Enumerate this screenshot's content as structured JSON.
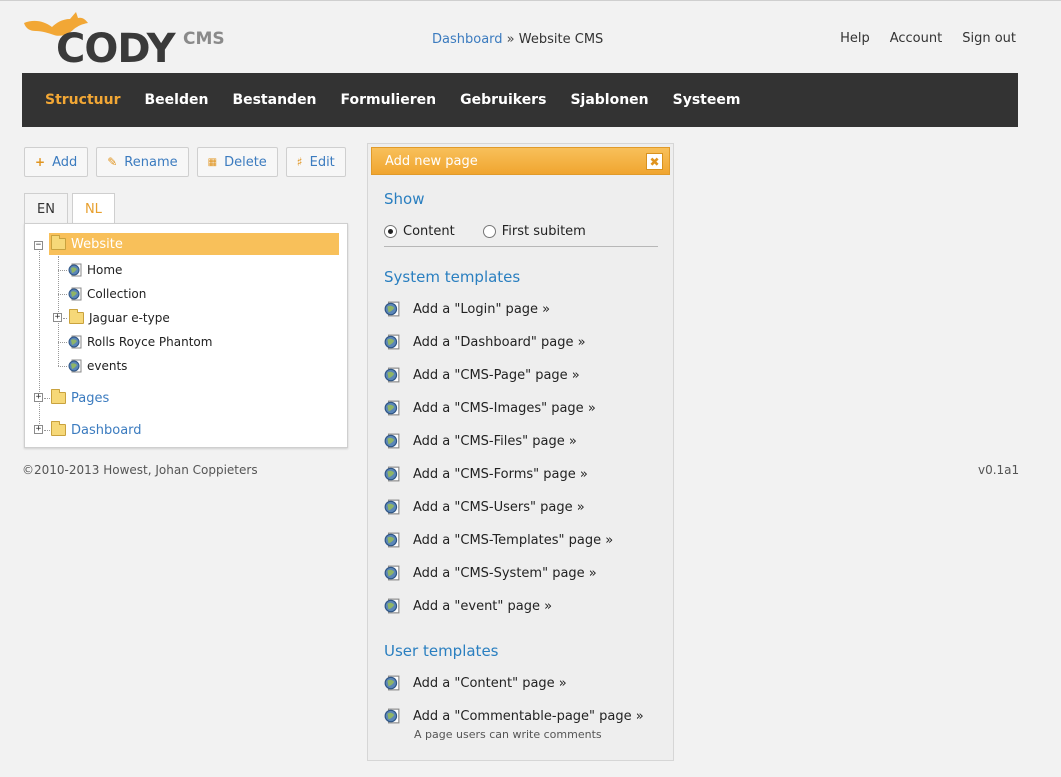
{
  "logo": {
    "word": "CODY",
    "suffix": "CMS"
  },
  "breadcrumb": {
    "link": "Dashboard",
    "separator": "»",
    "current": "Website CMS"
  },
  "toplinks": [
    "Help",
    "Account",
    "Sign out"
  ],
  "nav": {
    "items": [
      "Structuur",
      "Beelden",
      "Bestanden",
      "Formulieren",
      "Gebruikers",
      "Sjablonen",
      "Systeem"
    ],
    "active": "Structuur"
  },
  "toolbar": {
    "add": "Add",
    "add_icon": "+",
    "rename": "Rename",
    "rename_icon": "✎",
    "delete": "Delete",
    "delete_icon": "🗑",
    "edit": "Edit",
    "edit_icon": "🔧"
  },
  "tabs": {
    "en": "EN",
    "nl": "NL"
  },
  "tree": {
    "website": "Website",
    "home": "Home",
    "collection": "Collection",
    "jaguar": "Jaguar e-type",
    "rolls": "Rolls Royce Phantom",
    "events": "events",
    "pages": "Pages",
    "dashboard": "Dashboard"
  },
  "footer": {
    "copyright": "©2010-2013 Howest, Johan Coppieters",
    "version": "v0.1a1"
  },
  "panel": {
    "title": "Add new page",
    "close_icon": "✖",
    "show_heading": "Show",
    "show_options": [
      "Content",
      "First subitem"
    ],
    "show_selected": 0,
    "system_heading": "System templates",
    "system_templates": [
      "Add a \"Login\" page »",
      "Add a \"Dashboard\" page »",
      "Add a \"CMS-Page\" page »",
      "Add a \"CMS-Images\" page »",
      "Add a \"CMS-Files\" page »",
      "Add a \"CMS-Forms\" page »",
      "Add a \"CMS-Users\" page »",
      "Add a \"CMS-Templates\" page »",
      "Add a \"CMS-System\" page »",
      "Add a \"event\" page »"
    ],
    "user_heading": "User templates",
    "user_templates": [
      {
        "label": "Add a \"Content\" page »",
        "desc": ""
      },
      {
        "label": "Add a \"Commentable-page\" page »",
        "desc": "A page users can write comments"
      }
    ]
  },
  "colors": {
    "accent": "#f2a735",
    "link": "#3b7bbf",
    "nav_bg": "#333333",
    "heading": "#2a7fc0"
  }
}
